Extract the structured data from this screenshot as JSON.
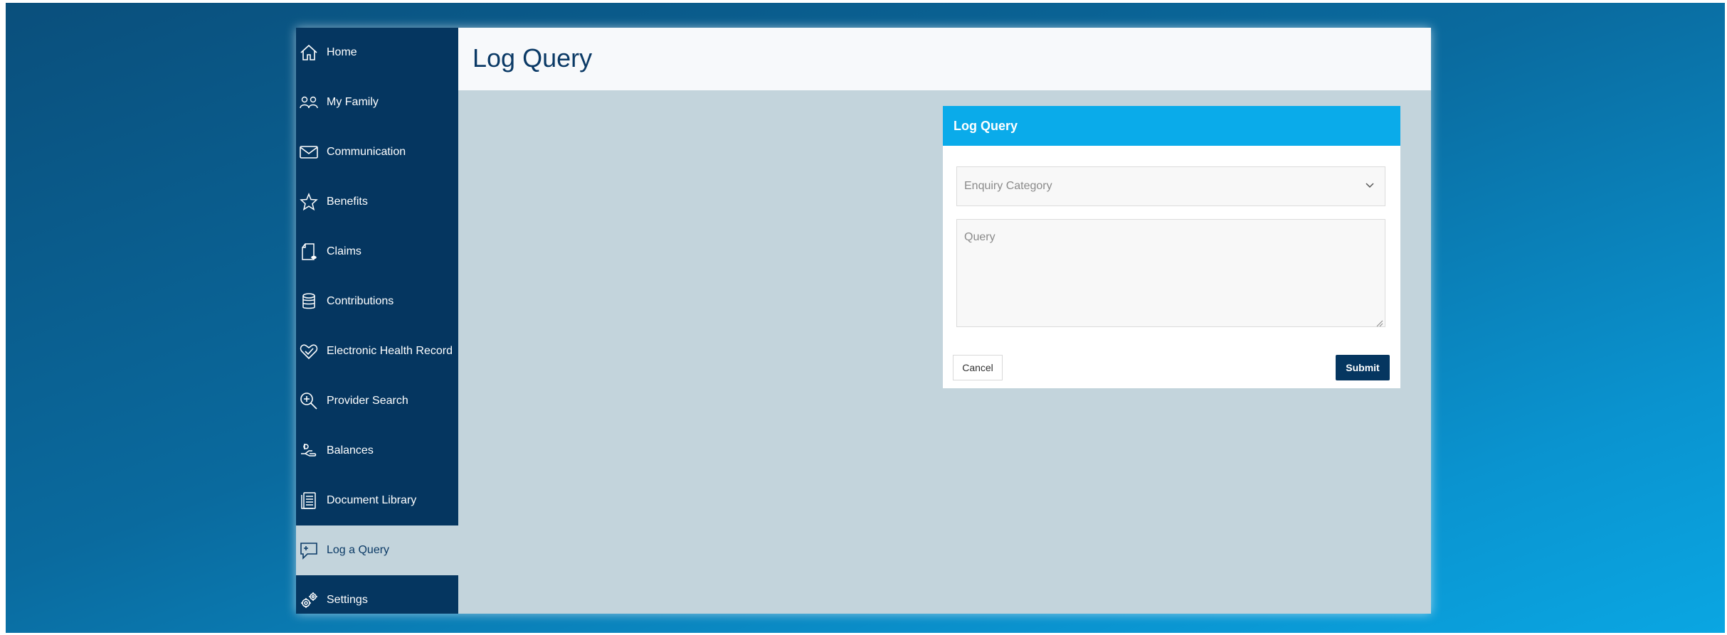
{
  "page": {
    "title": "Log Query"
  },
  "sidebar": {
    "items": [
      {
        "label": "Home",
        "icon": "home-icon"
      },
      {
        "label": "My Family",
        "icon": "family-icon"
      },
      {
        "label": "Communication",
        "icon": "envelope-icon"
      },
      {
        "label": "Benefits",
        "icon": "star-icon"
      },
      {
        "label": "Claims",
        "icon": "claims-document-icon"
      },
      {
        "label": "Contributions",
        "icon": "database-icon"
      },
      {
        "label": "Electronic Health Record",
        "icon": "heart-check-icon"
      },
      {
        "label": "Provider Search",
        "icon": "search-plus-icon"
      },
      {
        "label": "Balances",
        "icon": "hand-coins-icon"
      },
      {
        "label": "Document Library",
        "icon": "documents-icon"
      },
      {
        "label": "Log a Query",
        "icon": "chat-plus-icon",
        "active": true
      },
      {
        "label": "Settings",
        "icon": "gears-icon"
      }
    ]
  },
  "form": {
    "header": "Log Query",
    "category_placeholder": "Enquiry Category",
    "query_placeholder": "Query",
    "cancel_label": "Cancel",
    "submit_label": "Submit"
  },
  "colors": {
    "sidebar_bg": "#053660",
    "content_bg": "#c3d4dc",
    "panel_header": "#0aabea",
    "submit_bg": "#053660"
  }
}
